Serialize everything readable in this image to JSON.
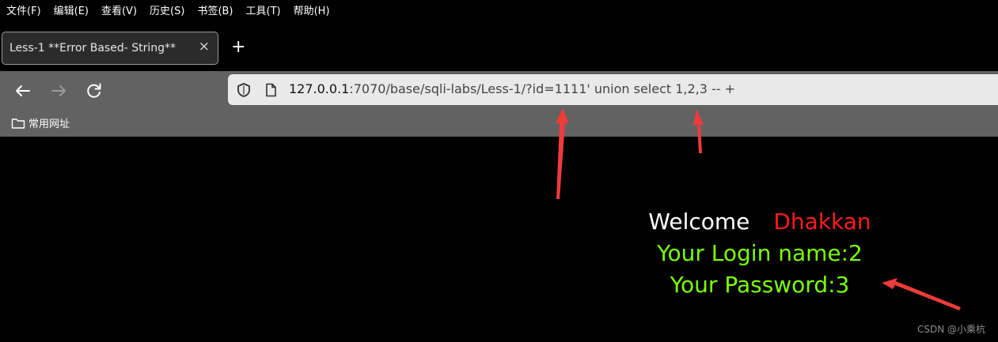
{
  "menu": [
    "文件(F)",
    "编辑(E)",
    "查看(V)",
    "历史(S)",
    "书签(B)",
    "工具(T)",
    "帮助(H)"
  ],
  "tab": {
    "title": "Less-1 **Error Based- String**",
    "close": "×"
  },
  "new_tab": "+",
  "nav": {
    "back": "arrow-left-icon",
    "forward": "arrow-right-icon",
    "reload": "reload-icon"
  },
  "url": {
    "host": "127.0.0.1",
    "rest": ":7070/base/sqli-labs/Less-1/?id=1111' union select 1,2,3 -- +"
  },
  "bookmarks": [
    {
      "label": "常用网址",
      "icon": "folder-icon"
    }
  ],
  "page": {
    "welcome": "Welcome",
    "name": "Dhakkan",
    "login": "Your Login name:2",
    "password": "Your Password:3"
  },
  "watermark": "CSDN @小乘杭",
  "colors": {
    "annotation_arrow": "#ee3b3b",
    "login_text": "#7cff00",
    "name_text": "#ff1a1a"
  }
}
